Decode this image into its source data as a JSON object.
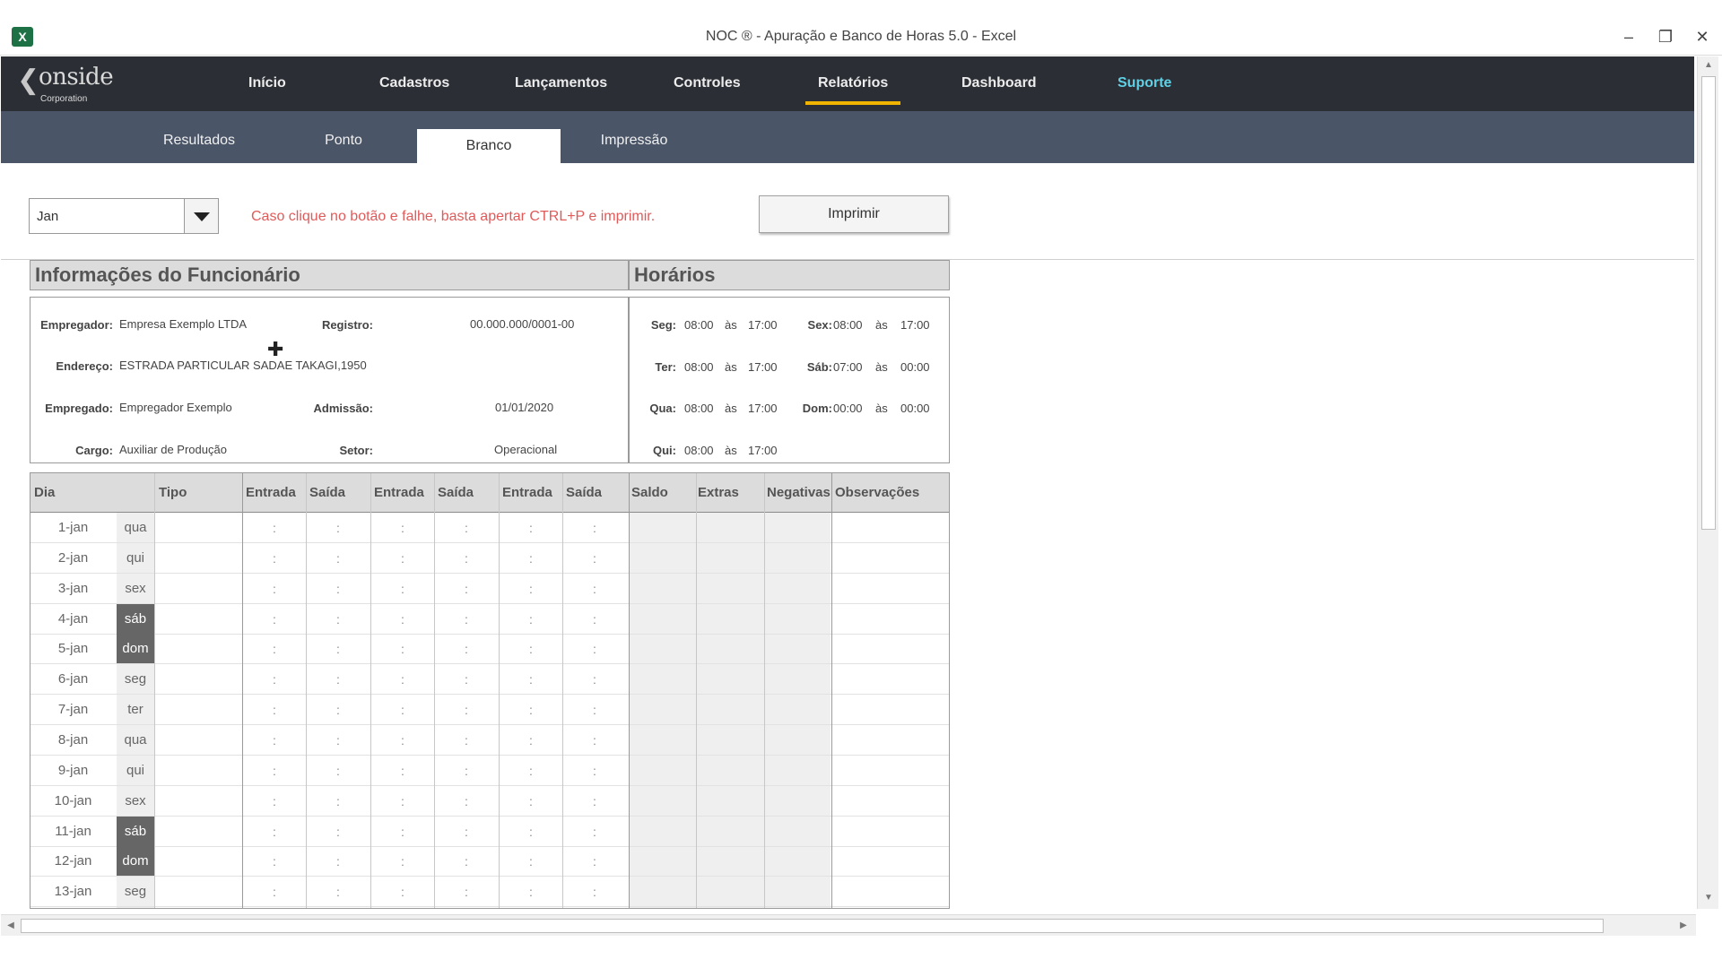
{
  "window": {
    "title": "NOC ® - Apuração e Banco de Horas 5.0 - Excel",
    "app_icon": "X",
    "controls": {
      "minimize": "–",
      "restore": "❐",
      "close": "✕"
    }
  },
  "brand": {
    "name": "onside",
    "sub": "Corporation",
    "chevron": "❮"
  },
  "nav": {
    "items": [
      "Início",
      "Cadastros",
      "Lançamentos",
      "Controles",
      "Relatórios",
      "Dashboard",
      "Suporte"
    ],
    "active": "Relatórios",
    "support_color": "#5fd0e6",
    "active_underline_color": "#f0b400"
  },
  "subnav": {
    "tabs": [
      "Resultados",
      "Ponto",
      "Branco",
      "Impressão"
    ],
    "active": "Branco"
  },
  "controls": {
    "month": "Jan",
    "warning": "Caso clique no botão e falhe, basta apertar CTRL+P e imprimir.",
    "print_button": "Imprimir"
  },
  "employee": {
    "section_title": "Informações do Funcionário",
    "empregador_label": "Empregador:",
    "empregador": "Empresa Exemplo LTDA",
    "registro_label": "Registro:",
    "registro": "00.000.000/0001-00",
    "endereco_label": "Endereço:",
    "endereco": "ESTRADA PARTICULAR SADAE TAKAGI,1950",
    "empregado_label": "Empregado:",
    "empregado": "Empregador Exemplo",
    "admissao_label": "Admissão:",
    "admissao": "01/01/2020",
    "cargo_label": "Cargo:",
    "cargo": "Auxiliar de Produção",
    "setor_label": "Setor:",
    "setor": "Operacional"
  },
  "schedule": {
    "section_title": "Horários",
    "sep": "às",
    "left": [
      {
        "day": "Seg:",
        "start": "08:00",
        "end": "17:00"
      },
      {
        "day": "Ter:",
        "start": "08:00",
        "end": "17:00"
      },
      {
        "day": "Qua:",
        "start": "08:00",
        "end": "17:00"
      },
      {
        "day": "Qui:",
        "start": "08:00",
        "end": "17:00"
      }
    ],
    "right": [
      {
        "day": "Sex:",
        "start": "08:00",
        "end": "17:00"
      },
      {
        "day": "Sáb:",
        "start": "07:00",
        "end": "00:00"
      },
      {
        "day": "Dom:",
        "start": "00:00",
        "end": "00:00"
      }
    ]
  },
  "table": {
    "headers": [
      "Dia",
      "Tipo",
      "Entrada",
      "Saída",
      "Entrada",
      "Saída",
      "Entrada",
      "Saída",
      "Saldo",
      "Extras",
      "Negativas",
      "Observações"
    ],
    "colon": ":",
    "rows": [
      {
        "day": "1-jan",
        "wd": "qua",
        "weekend": false
      },
      {
        "day": "2-jan",
        "wd": "qui",
        "weekend": false
      },
      {
        "day": "3-jan",
        "wd": "sex",
        "weekend": false
      },
      {
        "day": "4-jan",
        "wd": "sáb",
        "weekend": true
      },
      {
        "day": "5-jan",
        "wd": "dom",
        "weekend": true
      },
      {
        "day": "6-jan",
        "wd": "seg",
        "weekend": false
      },
      {
        "day": "7-jan",
        "wd": "ter",
        "weekend": false
      },
      {
        "day": "8-jan",
        "wd": "qua",
        "weekend": false
      },
      {
        "day": "9-jan",
        "wd": "qui",
        "weekend": false
      },
      {
        "day": "10-jan",
        "wd": "sex",
        "weekend": false
      },
      {
        "day": "11-jan",
        "wd": "sáb",
        "weekend": true
      },
      {
        "day": "12-jan",
        "wd": "dom",
        "weekend": true
      },
      {
        "day": "13-jan",
        "wd": "seg",
        "weekend": false
      }
    ]
  },
  "scroll": {
    "up": "▲",
    "down": "▼",
    "left": "◀",
    "right": "▶"
  },
  "cursor_glyph": "✚"
}
